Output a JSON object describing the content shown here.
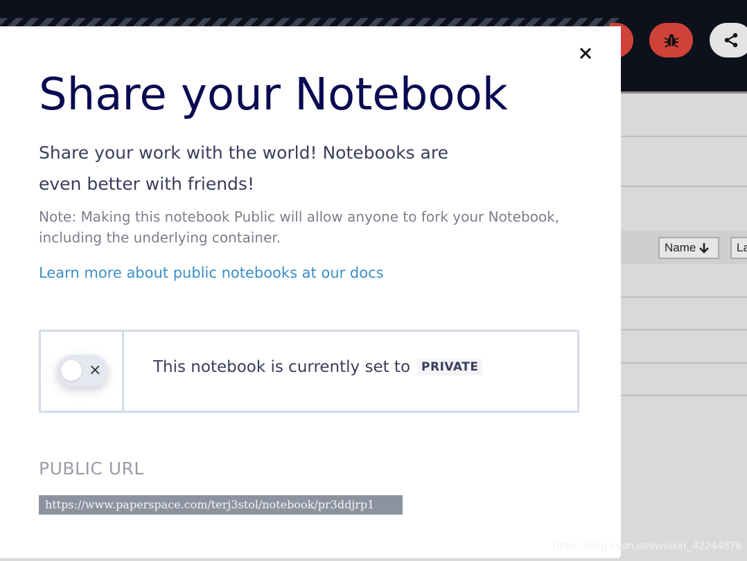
{
  "header": {
    "buttons": [
      {
        "name": "bug-button",
        "icon": "bug-icon",
        "color": "#d0413a"
      },
      {
        "name": "share-button",
        "icon": "share-icon",
        "color": "#e4e4e4"
      }
    ]
  },
  "background_table": {
    "sort_name_label": "Name",
    "sort_second_label": "La"
  },
  "modal": {
    "title": "Share your Notebook",
    "subtitle": "Share your work with the world! Notebooks are even better with friends!",
    "note": "Note: Making this notebook Public will allow anyone to fork your Notebook, including the underlying container.",
    "docs_link": "Learn more about public notebooks at our docs",
    "privacy": {
      "text": "This notebook is currently set to",
      "status": "PRIVATE",
      "toggle_on": false,
      "toggle_off_symbol": "×"
    },
    "public_url": {
      "label": "PUBLIC URL",
      "value": "https://www.paperspace.com/terj3stol/notebook/pr3ddjrp1"
    },
    "close_symbol": "×"
  },
  "watermark": "https://blog.csdn.net/weixin_42244879",
  "colors": {
    "title": "#0a0a52",
    "link": "#3a8ec7",
    "danger": "#d0413a",
    "topbar": "#0d111c"
  }
}
